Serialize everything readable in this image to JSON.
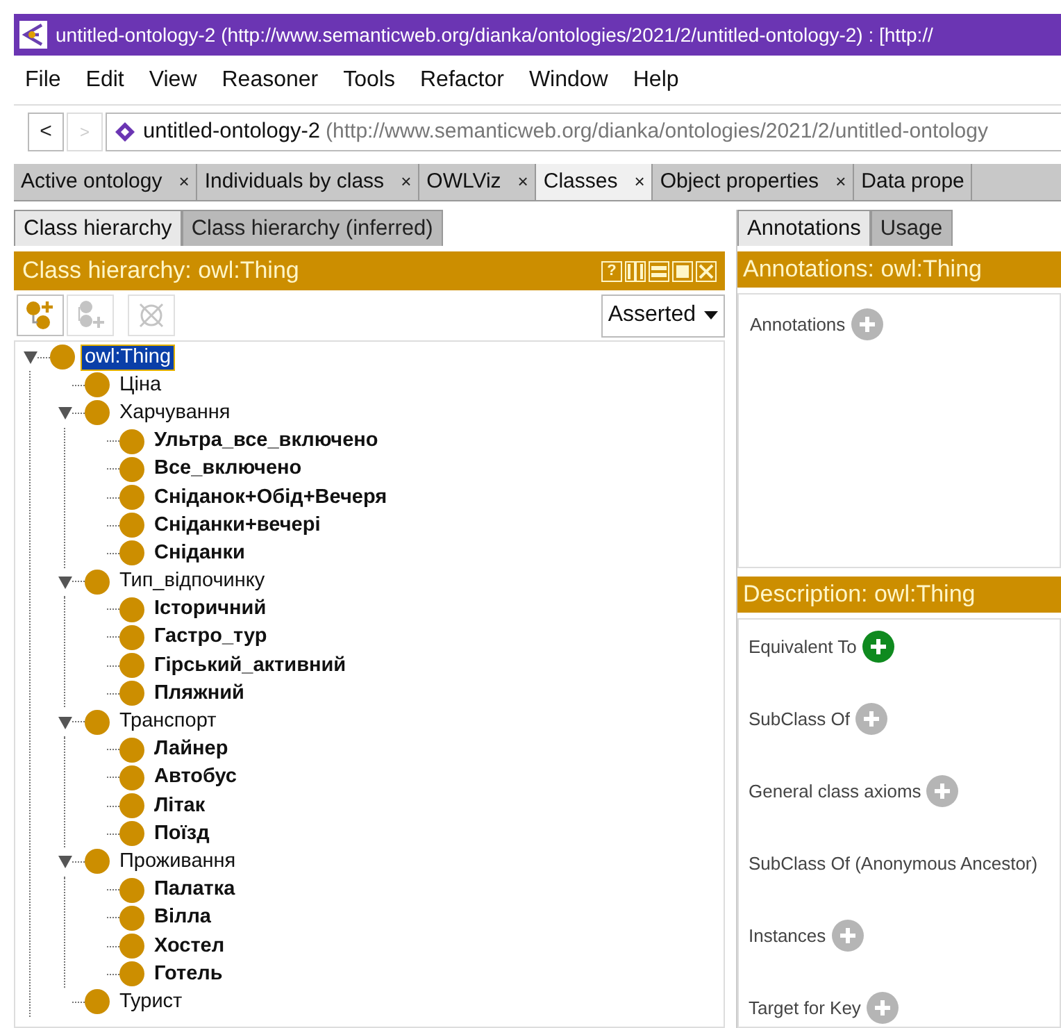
{
  "window": {
    "title": "untitled-ontology-2 (http://www.semanticweb.org/dianka/ontologies/2021/2/untitled-ontology-2)  : [http://"
  },
  "menu": [
    "File",
    "Edit",
    "View",
    "Reasoner",
    "Tools",
    "Refactor",
    "Window",
    "Help"
  ],
  "nav": {
    "back": "<",
    "forward": ">",
    "name": "untitled-ontology-2",
    "iri": "(http://www.semanticweb.org/dianka/ontologies/2021/2/untitled-ontology"
  },
  "tabs": [
    {
      "label": "Active ontology",
      "close": "×",
      "selected": false
    },
    {
      "label": "Individuals by class",
      "close": "×",
      "selected": false
    },
    {
      "label": "OWLViz",
      "close": "×",
      "selected": false
    },
    {
      "label": "Classes",
      "close": "×",
      "selected": true
    },
    {
      "label": "Object properties",
      "close": "×",
      "selected": false
    },
    {
      "label": "Data prope",
      "selected": false
    }
  ],
  "left": {
    "subtabs": [
      {
        "label": "Class hierarchy",
        "selected": true
      },
      {
        "label": "Class hierarchy (inferred)",
        "selected": false
      }
    ],
    "header": "Class hierarchy: owl:Thing",
    "help": "?",
    "toolbar": [
      {
        "kind": "add-sub",
        "disabled": false
      },
      {
        "kind": "add-sibling",
        "disabled": true
      },
      {
        "kind": "delete",
        "disabled": true
      }
    ],
    "mode": "Asserted",
    "tree": [
      {
        "label": "owl:Thing",
        "bold": false,
        "selected": true,
        "expanded": true,
        "children": [
          {
            "label": "Ціна",
            "bold": false,
            "selected": false
          },
          {
            "label": "Харчування",
            "bold": false,
            "selected": false,
            "expanded": true,
            "children": [
              {
                "label": "Ультра_все_включено",
                "bold": true,
                "selected": false
              },
              {
                "label": "Все_включено",
                "bold": true,
                "selected": false
              },
              {
                "label": "Сніданок+Обід+Вечеря",
                "bold": true,
                "selected": false
              },
              {
                "label": "Сніданки+вечері",
                "bold": true,
                "selected": false
              },
              {
                "label": "Сніданки",
                "bold": true,
                "selected": false
              }
            ]
          },
          {
            "label": "Тип_відпочинку",
            "bold": false,
            "selected": false,
            "expanded": true,
            "children": [
              {
                "label": "Історичний",
                "bold": true,
                "selected": false
              },
              {
                "label": "Гастро_тур",
                "bold": true,
                "selected": false
              },
              {
                "label": "Гірський_активний",
                "bold": true,
                "selected": false
              },
              {
                "label": "Пляжний",
                "bold": true,
                "selected": false
              }
            ]
          },
          {
            "label": "Транспорт",
            "bold": false,
            "selected": false,
            "expanded": true,
            "children": [
              {
                "label": "Лайнер",
                "bold": true,
                "selected": false
              },
              {
                "label": "Автобус",
                "bold": true,
                "selected": false
              },
              {
                "label": "Літак",
                "bold": true,
                "selected": false
              },
              {
                "label": "Поїзд",
                "bold": true,
                "selected": false
              }
            ]
          },
          {
            "label": "Проживання",
            "bold": false,
            "selected": false,
            "expanded": true,
            "children": [
              {
                "label": "Палатка",
                "bold": true,
                "selected": false
              },
              {
                "label": "Вілла",
                "bold": true,
                "selected": false
              },
              {
                "label": "Хостел",
                "bold": true,
                "selected": false
              },
              {
                "label": "Готель",
                "bold": true,
                "selected": false
              }
            ]
          },
          {
            "label": "Турист",
            "bold": false,
            "selected": false
          }
        ]
      }
    ]
  },
  "right": {
    "subtabs": [
      {
        "label": "Annotations",
        "selected": true
      },
      {
        "label": "Usage",
        "selected": false
      }
    ],
    "annotations_header": "Annotations: owl:Thing",
    "annotations": [
      {
        "label": "Annotations",
        "button": true,
        "enabled": false
      }
    ],
    "description_header": "Description: owl:Thing",
    "sections": [
      {
        "label": "Equivalent To",
        "button": true,
        "enabled": true
      },
      {
        "label": "SubClass Of",
        "button": true,
        "enabled": false
      },
      {
        "label": "General class axioms",
        "button": true,
        "enabled": false
      },
      {
        "label": "SubClass Of (Anonymous Ancestor)",
        "button": false
      },
      {
        "label": "Instances",
        "button": true,
        "enabled": false
      },
      {
        "label": "Target for Key",
        "button": true,
        "enabled": false
      }
    ]
  }
}
